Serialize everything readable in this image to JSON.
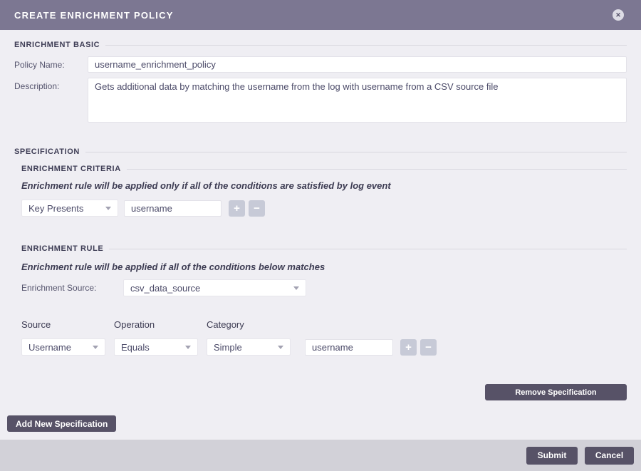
{
  "header": {
    "title": "CREATE ENRICHMENT POLICY"
  },
  "icons": {
    "close": "✕",
    "plus": "+",
    "minus": "−"
  },
  "colors": {
    "header_bg": "#7c7792",
    "body_bg": "#efeef3",
    "footer_bg": "#d2d1d8",
    "dark_button": "#575267",
    "plus_minus_button": "#c7cad7"
  },
  "basic": {
    "section_label": "ENRICHMENT BASIC",
    "policy_name_label": "Policy Name:",
    "policy_name_value": "username_enrichment_policy",
    "description_label": "Description:",
    "description_value": "Gets additional data by matching the username from the log with username from a CSV source file"
  },
  "specification": {
    "section_label": "SPECIFICATION",
    "criteria": {
      "section_label": "ENRICHMENT CRITERIA",
      "hint": "Enrichment rule will be applied only if all of the conditions are satisfied by log event",
      "condition_selected": "Key Presents",
      "condition_value": "username"
    },
    "rule": {
      "section_label": "ENRICHMENT RULE",
      "hint": "Enrichment rule will be applied if all of the conditions below matches",
      "enrichment_source_label": "Enrichment Source:",
      "enrichment_source_selected": "csv_data_source",
      "columns": {
        "source": "Source",
        "operation": "Operation",
        "category": "Category"
      },
      "row": {
        "source_selected": "Username",
        "operation_selected": "Equals",
        "category_selected": "Simple",
        "value": "username"
      }
    },
    "remove_button_label": "Remove Specification"
  },
  "add_new_button_label": "Add New Specification",
  "footer": {
    "submit_label": "Submit",
    "cancel_label": "Cancel"
  }
}
